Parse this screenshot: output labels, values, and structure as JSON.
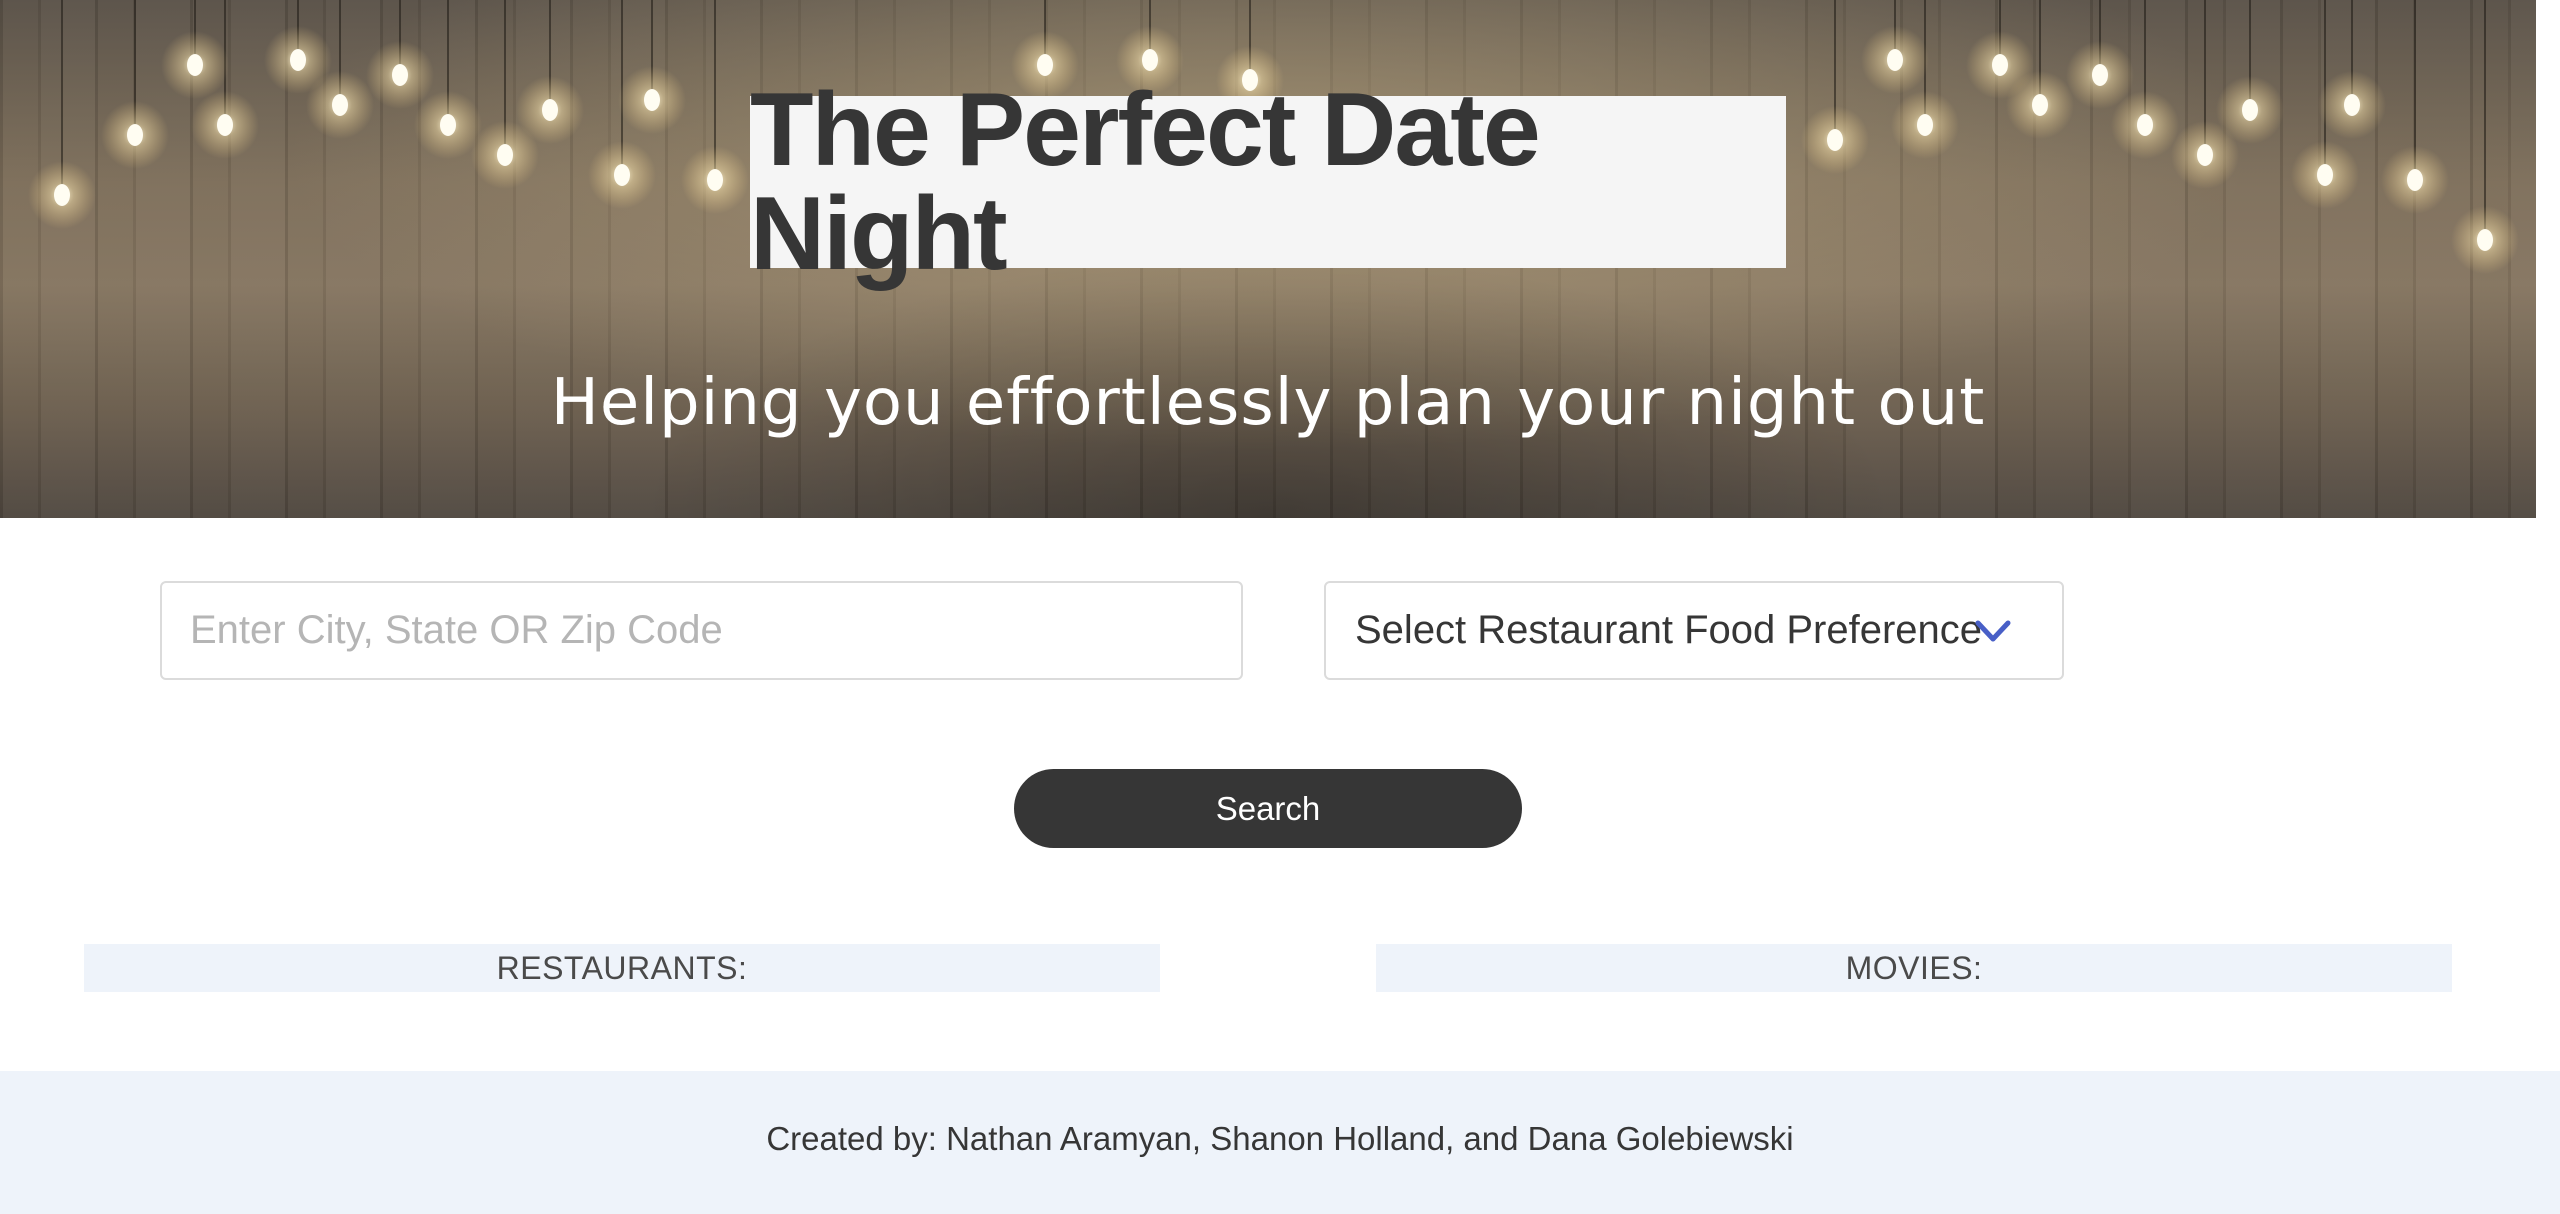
{
  "hero": {
    "title": "The Perfect Date Night",
    "subtitle": "Helping you effortlessly plan your night out"
  },
  "search": {
    "location_placeholder": "Enter City, State OR Zip Code",
    "location_value": "",
    "food_select_label": "Select Restaurant Food Preference",
    "food_select_icon": "chevron-down-icon",
    "button_label": "Search"
  },
  "results": {
    "restaurants_header": "RESTAURANTS:",
    "movies_header": "MOVIES:"
  },
  "footer": {
    "credits": "Created by: Nathan Aramyan, Shanon Holland, and Dana Golebiewski"
  },
  "colors": {
    "title_bg": "#f5f5f5",
    "dark": "#363636",
    "chevron": "#485fc7",
    "panel_bg": "#eef3fa",
    "border": "#dbdbdb"
  }
}
